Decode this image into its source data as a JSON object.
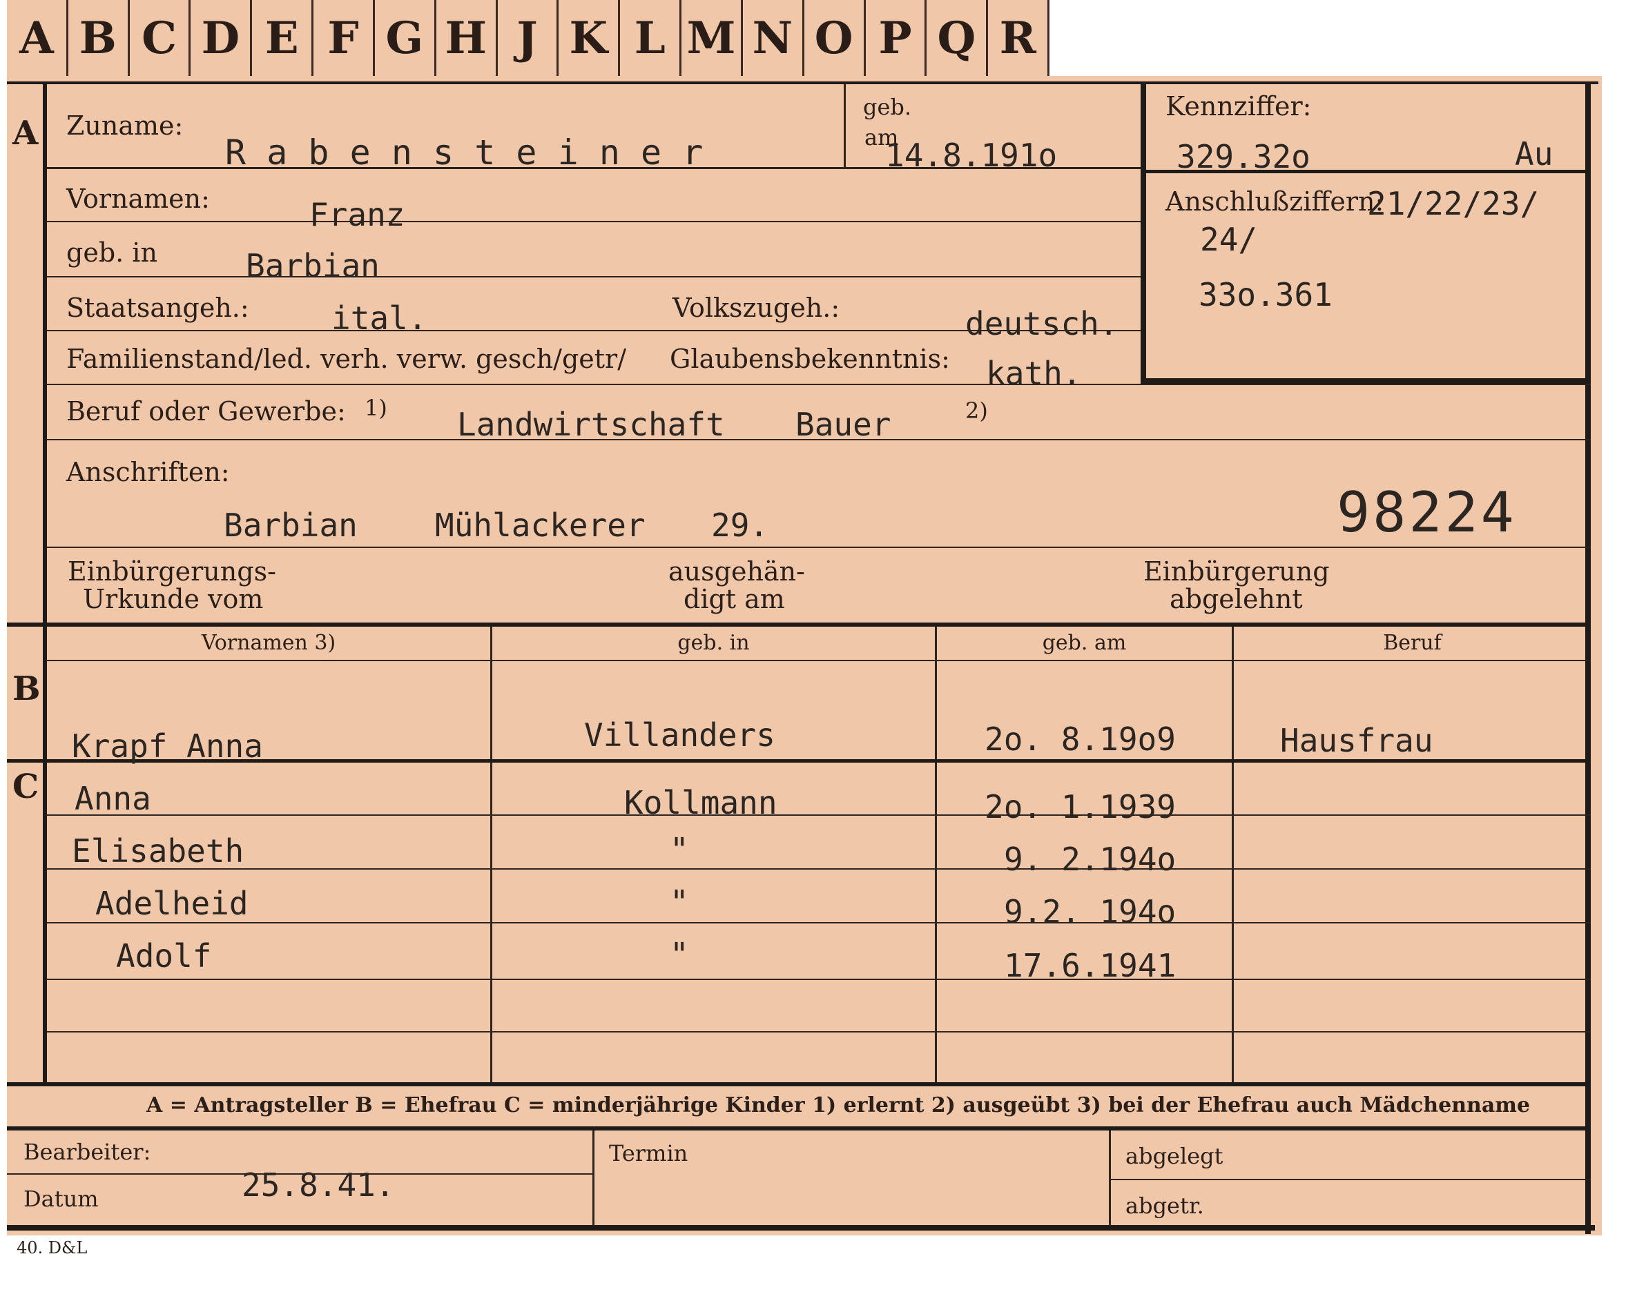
{
  "tabs": [
    "A",
    "B",
    "C",
    "D",
    "E",
    "F",
    "G",
    "H",
    "J",
    "K",
    "L",
    "M",
    "N",
    "O",
    "P",
    "Q",
    "R"
  ],
  "section_a": {
    "marker": "A",
    "zuname_label": "Zuname:",
    "zuname": "R a b e n s t e i n e r",
    "geb_label": "geb.",
    "am_label": "am",
    "geb_am": "14.8.191o",
    "kennziffer_label": "Kennziffer:",
    "kennziffer": "329.32o",
    "kennziffer_suffix": "Au",
    "anschluss_label": "Anschlußziffern:",
    "anschluss_1": "21/22/23/",
    "anschluss_2": "24/",
    "anschluss_3": "33o.361",
    "vornamen_label": "Vornamen:",
    "vornamen": "Franz",
    "geb_in_label": "geb. in",
    "geb_in": "Barbian",
    "staatsangeh_label": "Staatsangeh.:",
    "staatsangeh": "ital.",
    "volkszugeh_label": "Volkszugeh.:",
    "volkszugeh": "deutsch.",
    "familienstand_label": "Familienstand/led. verh. verw. gesch/getr/",
    "glaubens_label": "Glaubensbekenntnis:",
    "glaubens": "kath.",
    "beruf_label": "Beruf oder Gewerbe:",
    "fn1": "1)",
    "fn2": "2)",
    "beruf_1": "Landwirtschaft",
    "beruf_2": "Bauer",
    "anschriften_label": "Anschriften:",
    "addr_1": "Barbian",
    "addr_2": "Mühlackerer",
    "addr_3": "29.",
    "stamp_number": "98224",
    "einb_urkunde_1": "Einbürgerungs-",
    "einb_urkunde_2": "Urkunde vom",
    "ausgeh_1": "ausgehän-",
    "ausgeh_2": "digt am",
    "einb_abgel_1": "Einbürgerung",
    "einb_abgel_2": "abgelehnt"
  },
  "table_headers": [
    "Vornamen 3)",
    "geb. in",
    "geb. am",
    "Beruf"
  ],
  "section_b": {
    "marker": "B",
    "name": "Krapf  Anna",
    "geb_in": "Villanders",
    "geb_am": "2o. 8.19o9",
    "beruf": "Hausfrau"
  },
  "section_c": {
    "marker": "C",
    "rows": [
      {
        "name": "Anna",
        "geb_in": "Kollmann",
        "geb_am": "2o. 1.1939",
        "beruf": ""
      },
      {
        "name": "Elisabeth",
        "geb_in": "\"",
        "geb_am": "9. 2.194o",
        "beruf": ""
      },
      {
        "name": "Adelheid",
        "geb_in": "\"",
        "geb_am": "9.2. 194o",
        "beruf": ""
      },
      {
        "name": "Adolf",
        "geb_in": "\"",
        "geb_am": "17.6.1941",
        "beruf": ""
      }
    ]
  },
  "legend": "A = Antragsteller   B = Ehefrau   C = minderjährige Kinder   1) erlernt   2) ausgeübt   3) bei der Ehefrau auch Mädchenname",
  "footer": {
    "bearbeiter_label": "Bearbeiter:",
    "datum_label": "Datum",
    "datum": "25.8.41.",
    "termin_label": "Termin",
    "abgelegt_label": "abgelegt",
    "abgetr_label": "abgetr."
  },
  "print_mark": "40. D&L"
}
